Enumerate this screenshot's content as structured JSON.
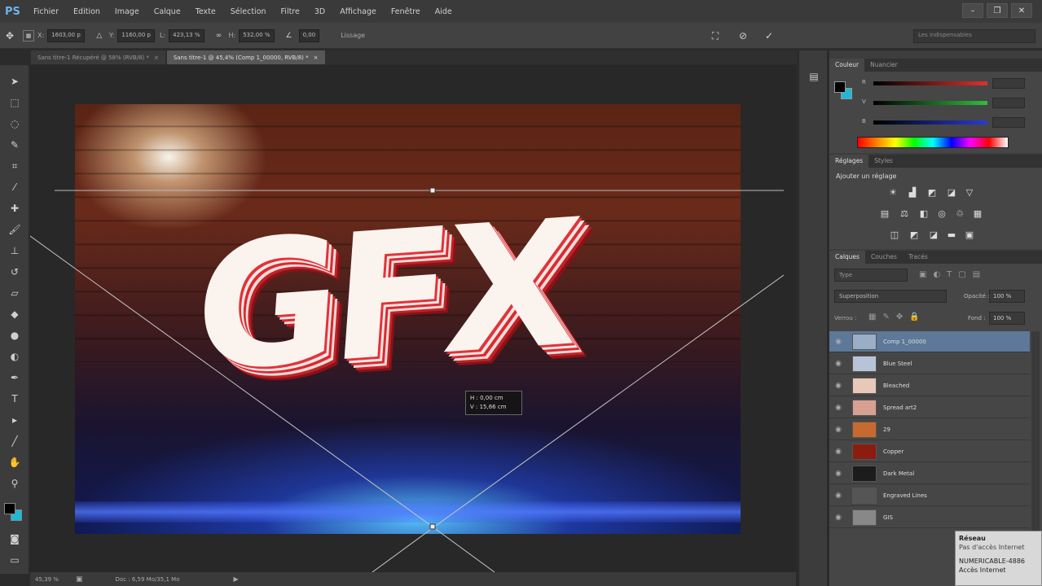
{
  "app": {
    "logo": "PS",
    "menu": [
      "Fichier",
      "Edition",
      "Image",
      "Calque",
      "Texte",
      "Sélection",
      "Filtre",
      "3D",
      "Affichage",
      "Fenêtre",
      "Aide"
    ],
    "window_controls": [
      "–",
      "❐",
      "✕"
    ]
  },
  "options_bar": {
    "x_label": "X:",
    "x_value": "1603,00 p",
    "y_label": "Y:",
    "y_value": "1160,00 p",
    "w_label": "L:",
    "w_value": "423,13 %",
    "h_label": "H:",
    "h_value": "532,00 %",
    "angle_value": "0,00",
    "interp_label": "Lissage",
    "workspace": "Les indispensables"
  },
  "tabs": [
    {
      "label": "Sans titre-1 Récupéré @ 58% (RVB/8) *",
      "close": "×",
      "active": false
    },
    {
      "label": "Sans titre-1 @ 45,4% (Comp 1_00000, RVB/8) *",
      "close": "×",
      "active": true
    }
  ],
  "canvas": {
    "text": "GFX",
    "readout_line1": "H : 0,00 cm",
    "readout_line2": "V : 15,66 cm"
  },
  "status": {
    "zoom": "45,39 %",
    "doc": "Doc : 6,59 Mo/35,1 Mo"
  },
  "color_panel": {
    "tabs": [
      "Couleur",
      "Nuancier"
    ],
    "channels": [
      {
        "label": "R",
        "color": "#e0302c"
      },
      {
        "label": "V",
        "color": "#2fbf3c"
      },
      {
        "label": "B",
        "color": "#2a3ad8"
      }
    ],
    "fg_color": "#000000",
    "bg_color": "#1fb9d8"
  },
  "adjust_panel": {
    "tabs": [
      "Réglages",
      "Styles"
    ],
    "title": "Ajouter un réglage"
  },
  "layers_panel": {
    "tabs": [
      "Calques",
      "Couches",
      "Tracés"
    ],
    "filter": "Type",
    "blend_mode": "Superposition",
    "opacity_label": "Opacité :",
    "opacity_value": "100 %",
    "lock_label": "Verrou :",
    "fill_label": "Fond :",
    "fill_value": "100 %",
    "layers": [
      {
        "name": "Comp 1_00000",
        "selected": true,
        "thumb": "#9aaec8"
      },
      {
        "name": "Blue Steel",
        "selected": false,
        "thumb": "#b7c4d8"
      },
      {
        "name": "Bleached",
        "selected": false,
        "thumb": "#e8c8b8"
      },
      {
        "name": "Spread art2",
        "selected": false,
        "thumb": "#d8a090"
      },
      {
        "name": "29",
        "selected": false,
        "thumb": "#c86a30"
      },
      {
        "name": "Copper",
        "selected": false,
        "thumb": "#8a1c10"
      },
      {
        "name": "Dark Metal",
        "selected": false,
        "thumb": "#1c1c1c"
      },
      {
        "name": "Engraved Lines",
        "selected": false,
        "thumb": "#555555"
      },
      {
        "name": "GIS",
        "selected": false,
        "thumb": "#888888"
      }
    ]
  },
  "network_tooltip": {
    "title": "Réseau",
    "subtitle": "Pas d'accès Internet",
    "line1": "NUMERICABLE-4886",
    "line2": "Accès Internet"
  },
  "colors": {
    "selected_layer": "#5d7898",
    "accent": "#6fb3e8"
  }
}
